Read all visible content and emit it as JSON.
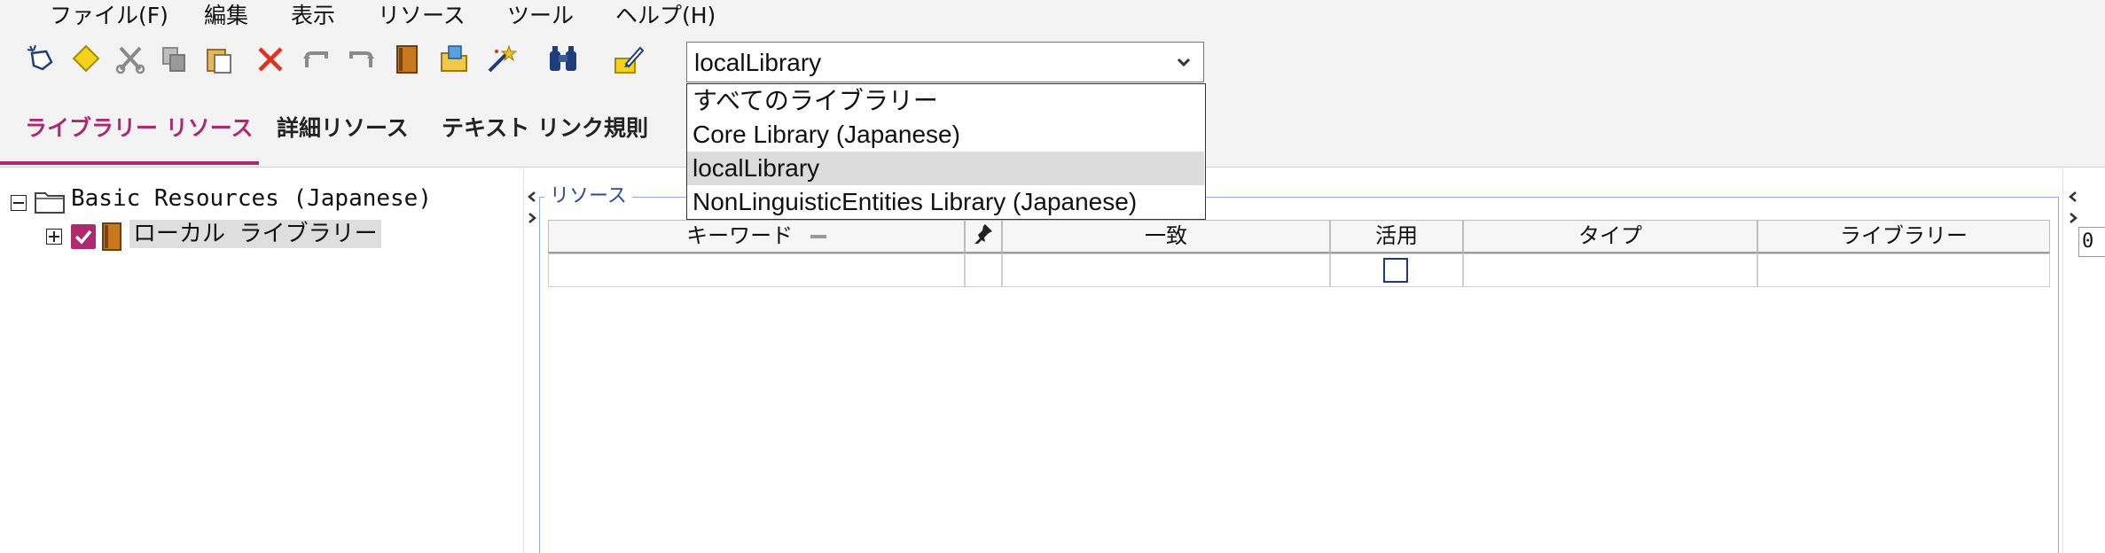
{
  "menubar": {
    "items": [
      "ファイル(F)",
      "編集",
      "表示",
      "リソース",
      "ツール",
      "ヘルプ(H)"
    ]
  },
  "toolbar": {
    "icons": [
      "new-icon",
      "diamond-icon",
      "cut-icon",
      "copy-icon",
      "paste-icon",
      "delete-icon",
      "undo-icon",
      "redo-icon",
      "book-icon",
      "open-folder-icon",
      "magic-wand-icon",
      "binoculars-icon",
      "edit-icon"
    ]
  },
  "library_combo": {
    "value": "localLibrary",
    "options": [
      "すべてのライブラリー",
      "Core Library (Japanese)",
      "localLibrary",
      "NonLinguisticEntities Library (Japanese)"
    ],
    "selected_index": 2
  },
  "tabs": [
    "ライブラリー リソース",
    "詳細リソース",
    "テキスト リンク規則"
  ],
  "active_tab": 0,
  "tree": {
    "root": "Basic Resources (Japanese)",
    "child": "ローカル ライブラリー"
  },
  "resources": {
    "legend": "リソース",
    "columns": [
      "キーワード",
      "",
      "一致",
      "活用",
      "タイプ",
      "ライブラリー"
    ]
  },
  "right_field": {
    "value": "0"
  },
  "colors": {
    "accent": "#b0286e",
    "frame": "#8aaed6",
    "legend": "#2a4d8f"
  }
}
